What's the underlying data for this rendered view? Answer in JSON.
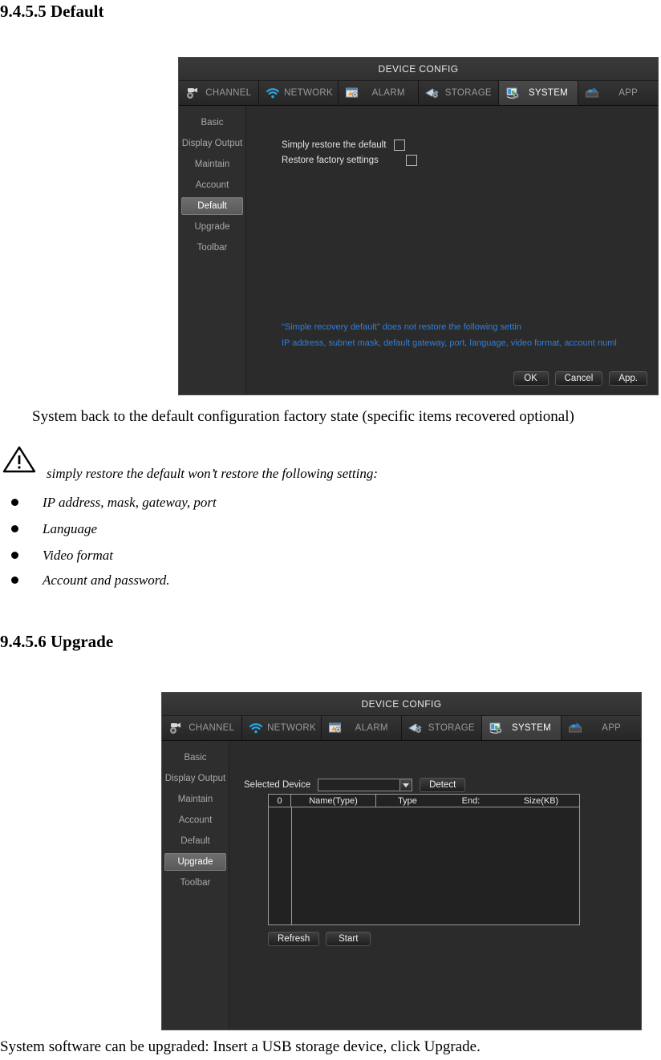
{
  "doc": {
    "heading1": "9.4.5.5 Default",
    "para1": "System back to the default configuration factory state (specific items recovered optional)",
    "warn_note": "simply restore the default won’t restore the following setting:",
    "bullets": [
      "IP address, mask, gateway, port",
      "Language",
      "Video format",
      "Account and password."
    ],
    "heading2": "9.4.5.6 Upgrade",
    "para2": "System software can be upgraded: Insert a USB storage device, click Upgrade."
  },
  "panel_default": {
    "title": "DEVICE CONFIG",
    "tabs": [
      {
        "label": "CHANNEL",
        "icon": "camera-icon",
        "active": false
      },
      {
        "label": "NETWORK",
        "icon": "wifi-icon",
        "active": false
      },
      {
        "label": "ALARM",
        "icon": "alarm-icon",
        "active": false
      },
      {
        "label": "STORAGE",
        "icon": "storage-icon",
        "active": false
      },
      {
        "label": "SYSTEM",
        "icon": "system-icon",
        "active": true
      },
      {
        "label": "APP",
        "icon": "app-icon",
        "active": false
      }
    ],
    "sidebar": [
      {
        "label": "Basic",
        "active": false
      },
      {
        "label": "Display Output",
        "active": false
      },
      {
        "label": "Maintain",
        "active": false
      },
      {
        "label": "Account",
        "active": false
      },
      {
        "label": "Default",
        "active": true
      },
      {
        "label": "Upgrade",
        "active": false
      },
      {
        "label": "Toolbar",
        "active": false
      }
    ],
    "checkboxes": [
      {
        "label": "Simply restore the default",
        "checked": false
      },
      {
        "label": "Restore factory settings",
        "checked": false
      }
    ],
    "notes": [
      "\"Simple recovery default\" does not restore the following settin",
      "IP address, subnet mask, default gateway, port, language, video format, account numl"
    ],
    "note_color": "#2f7fdd",
    "buttons": [
      "OK",
      "Cancel",
      "App."
    ]
  },
  "panel_upgrade": {
    "title": "DEVICE CONFIG",
    "tabs": [
      {
        "label": "CHANNEL",
        "icon": "camera-icon",
        "active": false
      },
      {
        "label": "NETWORK",
        "icon": "wifi-icon",
        "active": false
      },
      {
        "label": "ALARM",
        "icon": "alarm-icon",
        "active": false
      },
      {
        "label": "STORAGE",
        "icon": "storage-icon",
        "active": false
      },
      {
        "label": "SYSTEM",
        "icon": "system-icon",
        "active": true
      },
      {
        "label": "APP",
        "icon": "app-icon",
        "active": false
      }
    ],
    "sidebar": [
      {
        "label": "Basic",
        "active": false
      },
      {
        "label": "Display Output",
        "active": false
      },
      {
        "label": "Maintain",
        "active": false
      },
      {
        "label": "Account",
        "active": false
      },
      {
        "label": "Default",
        "active": false
      },
      {
        "label": "Upgrade",
        "active": true
      },
      {
        "label": "Toolbar",
        "active": false
      }
    ],
    "selected_device_label": "Selected Device",
    "selected_device_value": "",
    "detect_label": "Detect",
    "grid_headers": [
      "0",
      "Name(Type)",
      "Type",
      "End:",
      "Size(KB)"
    ],
    "grid_rows": [],
    "buttons": [
      "Refresh",
      "Start"
    ]
  }
}
